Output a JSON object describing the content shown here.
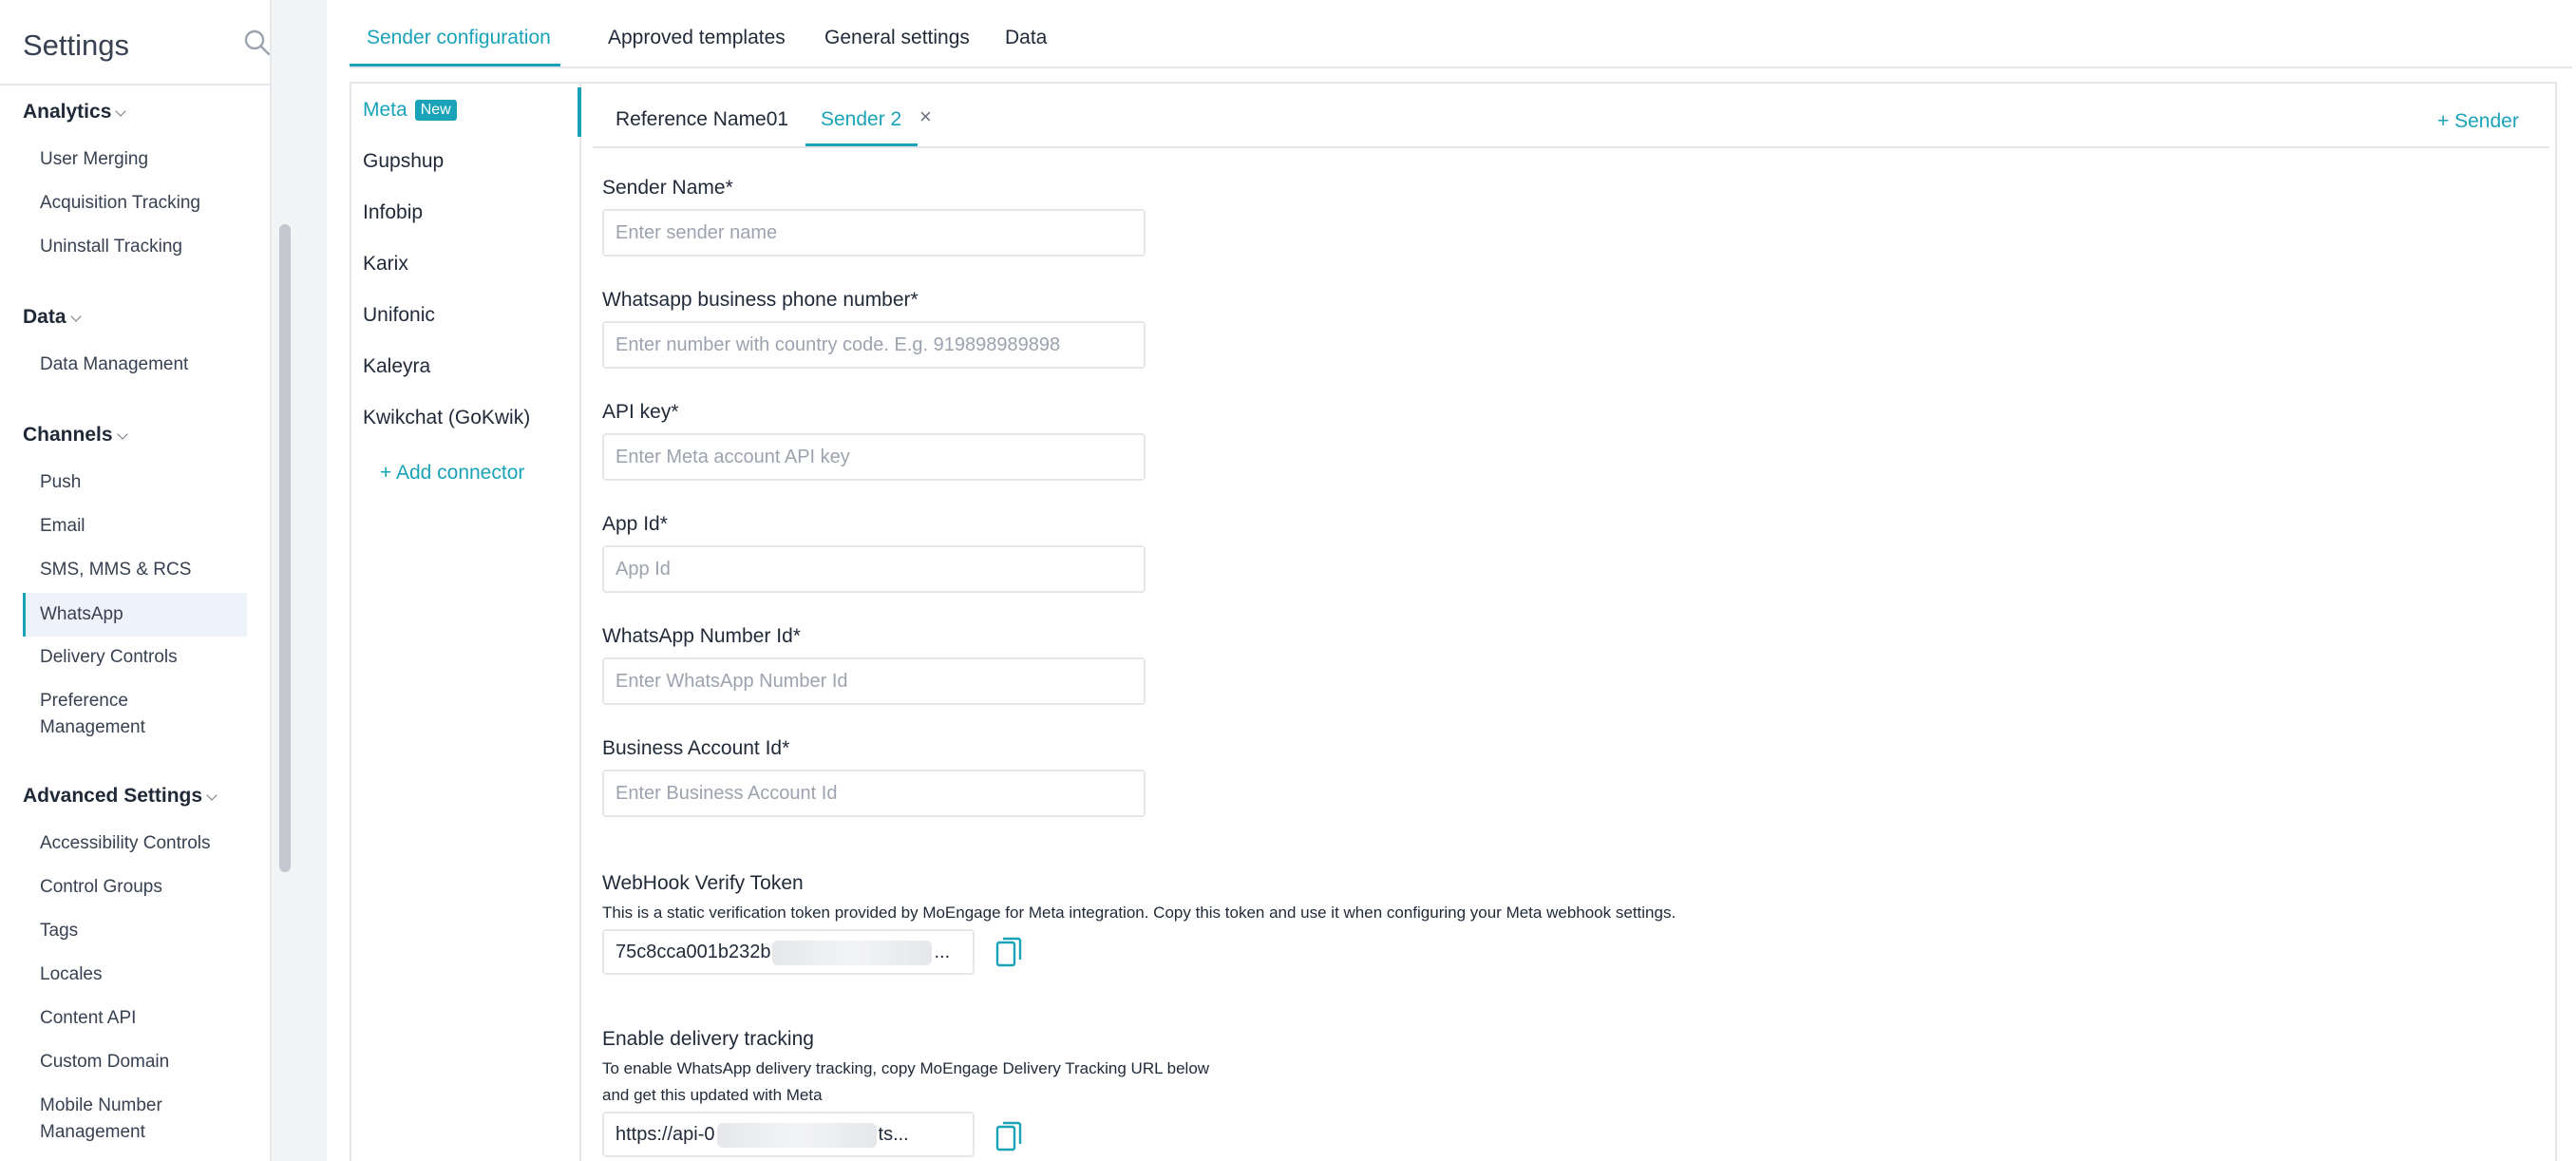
{
  "sidebar": {
    "title": "Settings",
    "groups": [
      {
        "label": "Analytics",
        "items": [
          "User Merging",
          "Acquisition Tracking",
          "Uninstall Tracking"
        ]
      },
      {
        "label": "Data",
        "items": [
          "Data Management"
        ]
      },
      {
        "label": "Channels",
        "items": [
          "Push",
          "Email",
          "SMS, MMS & RCS",
          "WhatsApp",
          "Delivery Controls",
          "Preference Management"
        ]
      },
      {
        "label": "Advanced Settings",
        "items": [
          "Accessibility Controls",
          "Control Groups",
          "Tags",
          "Locales",
          "Content API",
          "Custom Domain",
          "Mobile Number Management"
        ]
      }
    ],
    "preference_line1": "Preference",
    "preference_line2": "Management",
    "mobile_line1": "Mobile Number",
    "mobile_line2": "Management",
    "active_item": "WhatsApp"
  },
  "top_tabs": [
    "Sender configuration",
    "Approved templates",
    "General settings",
    "Data"
  ],
  "connectors": {
    "items": [
      "Meta",
      "Gupshup",
      "Infobip",
      "Karix",
      "Unifonic",
      "Kaleyra",
      "Kwikchat (GoKwik)"
    ],
    "new_badge": "New",
    "add_label": "+ Add connector"
  },
  "sender_tabs": [
    "Reference Name01",
    "Sender 2"
  ],
  "close_glyph": "×",
  "add_sender_label": "+ Sender",
  "form": {
    "sender_name": {
      "label": "Sender Name*",
      "placeholder": "Enter sender name"
    },
    "phone": {
      "label": "Whatsapp business phone number*",
      "placeholder": "Enter number with country code. E.g. 919898989898"
    },
    "api_key": {
      "label": "API key*",
      "placeholder": "Enter Meta account API key"
    },
    "app_id": {
      "label": "App Id*",
      "placeholder": "App Id"
    },
    "wa_number_id": {
      "label": "WhatsApp Number Id*",
      "placeholder": "Enter WhatsApp Number Id"
    },
    "business_id": {
      "label": "Business Account Id*",
      "placeholder": "Enter Business Account Id"
    },
    "webhook": {
      "label": "WebHook Verify Token",
      "help": "This is a static verification token provided by MoEngage for Meta integration. Copy this token and use it when configuring your Meta webhook settings.",
      "value_start": "75c8cca001b232b",
      "value_end": "..."
    },
    "delivery": {
      "label": "Enable delivery tracking",
      "help_line1": "To enable WhatsApp delivery tracking, copy MoEngage Delivery Tracking URL below",
      "help_line2": "and get this updated with Meta",
      "value_start": "https://api-0",
      "value_end": "ts..."
    }
  },
  "colors": {
    "accent": "#1aa3b8",
    "border": "#e5e7eb",
    "active_bg": "#eef2fb"
  }
}
